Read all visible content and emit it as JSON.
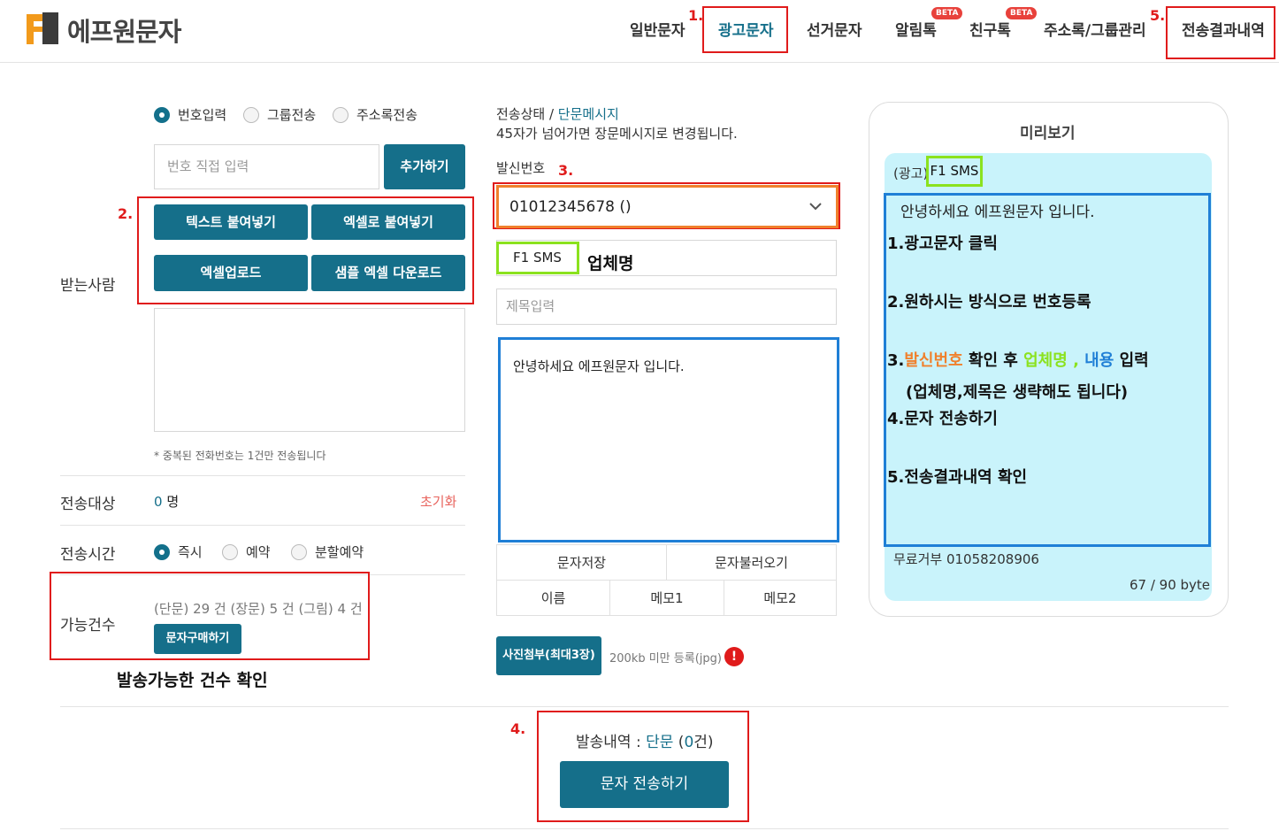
{
  "brand": {
    "name": "에프원문자"
  },
  "nav": {
    "items": [
      "일반문자",
      "광고문자",
      "선거문자",
      "알림톡",
      "친구톡",
      "주소록/그룹관리",
      "전송결과내역"
    ],
    "beta": "BETA",
    "active_index": 1
  },
  "steps": {
    "n1": "1.",
    "n2": "2.",
    "n3": "3.",
    "n4": "4.",
    "n5": "5."
  },
  "recipient": {
    "modes": [
      "번호입력",
      "그룹전송",
      "주소록전송"
    ],
    "number_placeholder": "번호 직접 입력",
    "add_button": "추가하기",
    "buttons": [
      "텍스트 붙여넣기",
      "엑셀로 붙여넣기",
      "엑셀업로드",
      "샘플 엑셀 다운로드"
    ],
    "label": "받는사람",
    "dup_note": "* 중복된 전화번호는 1건만 전송됩니다"
  },
  "target": {
    "label": "전송대상",
    "count": "0",
    "unit": "명",
    "reset": "초기화"
  },
  "send_time": {
    "label": "전송시간",
    "options": [
      "즉시",
      "예약",
      "분할예약"
    ]
  },
  "available": {
    "label": "가능건수",
    "summary": "(단문) 29 건 (장문) 5 건 (그림) 4 건",
    "buy_button": "문자구매하기",
    "annotation": "발송가능한 건수 확인"
  },
  "status": {
    "prefix": "전송상태 / ",
    "type": "단문메시지",
    "note": "45자가 넘어가면 장문메시지로 변경됩니다."
  },
  "sender": {
    "label": "발신번호",
    "value": "01012345678 ()"
  },
  "company": {
    "value": "F1 SMS",
    "annotation": "업체명"
  },
  "subject": {
    "placeholder": "제목입력"
  },
  "message": {
    "value": "안녕하세요 에프원문자 입니다."
  },
  "msg_actions": {
    "save": "문자저장",
    "load": "문자불러오기",
    "name": "이름",
    "memo1": "메모1",
    "memo2": "메모2"
  },
  "attach": {
    "button": "사진첨부(최대3장)",
    "note": "200kb 미만 등록(jpg)",
    "alert": "!"
  },
  "send": {
    "prefix": "발송내역 : ",
    "type": "단문",
    "count_prefix": " (",
    "count": "0",
    "count_suffix": "건)",
    "button": "문자 전송하기"
  },
  "preview": {
    "title": "미리보기",
    "ad_tag": "(광고)",
    "company": "F1 SMS",
    "body": "안녕하세요 에프원문자 입니다.",
    "guide": {
      "l1": "1.광고문자 클릭",
      "l2": "2.원하시는 방식으로 번호등록",
      "l3_a": "3.",
      "l3_b": "발신번호",
      "l3_c": " 확인 후 ",
      "l3_d": "업체명",
      "l3_e": " , ",
      "l3_f": "내용",
      "l3_g": " 입력",
      "l3_note": "(업체명,제목은 생략해도 됩니다)",
      "l4": "4.문자 전송하기",
      "l5": "5.전송결과내역 확인"
    },
    "reject": "무료거부 01058208906",
    "bytes": "67 / 90 byte"
  },
  "colors": {
    "accent": "#156f8a",
    "red": "#e01b1b",
    "orange": "#f0802c",
    "green": "#8be21e",
    "blue": "#1f7fd6",
    "preview_bg": "#c9f3fb"
  }
}
